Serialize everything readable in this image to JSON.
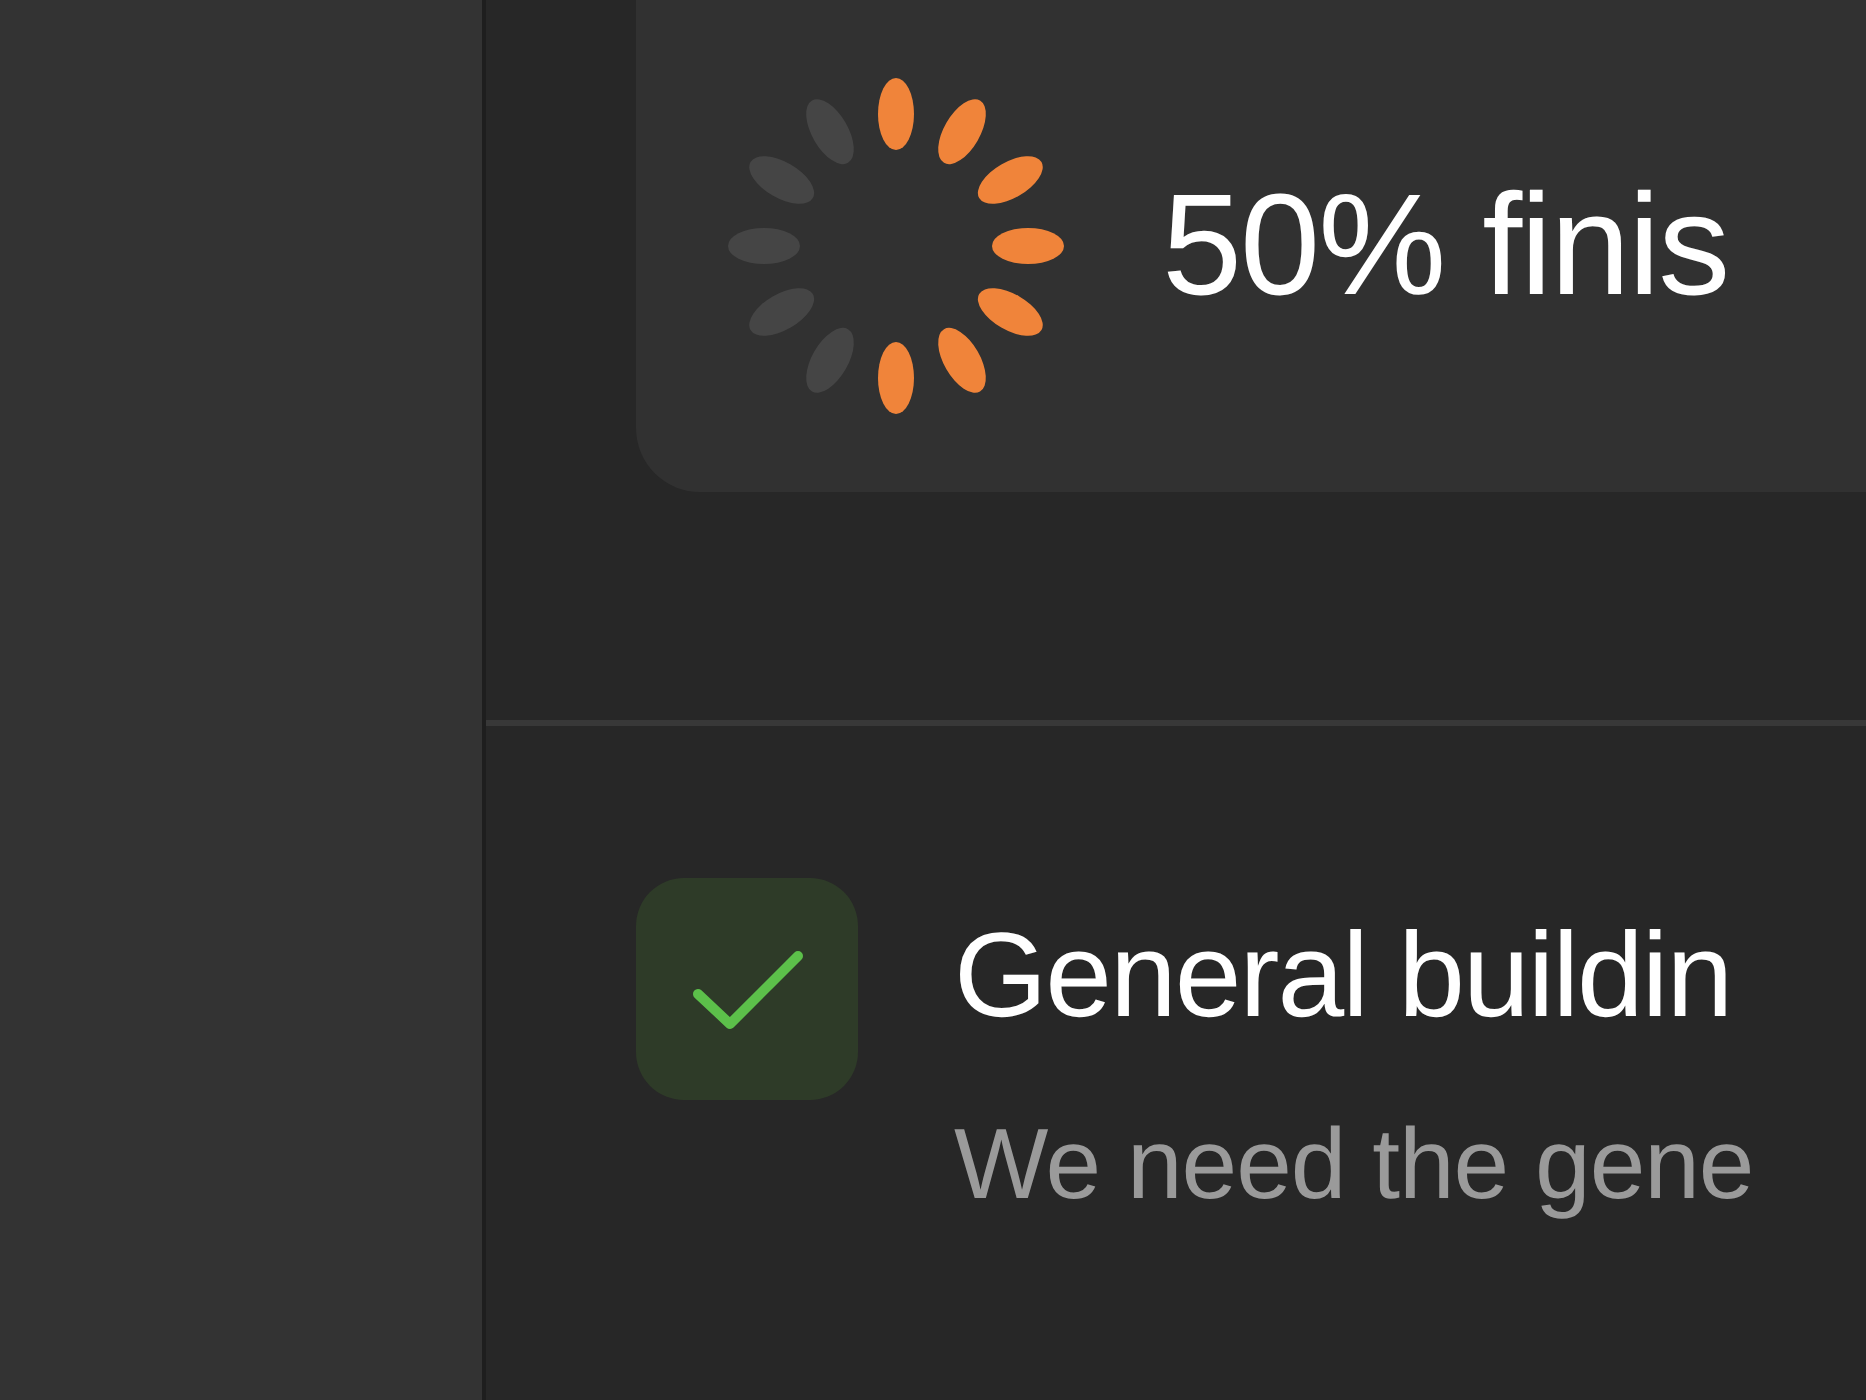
{
  "progress": {
    "level": 0.58,
    "label": "50% finis"
  },
  "task": {
    "checked": true,
    "title": "General buildin",
    "description": "We need the gene"
  }
}
